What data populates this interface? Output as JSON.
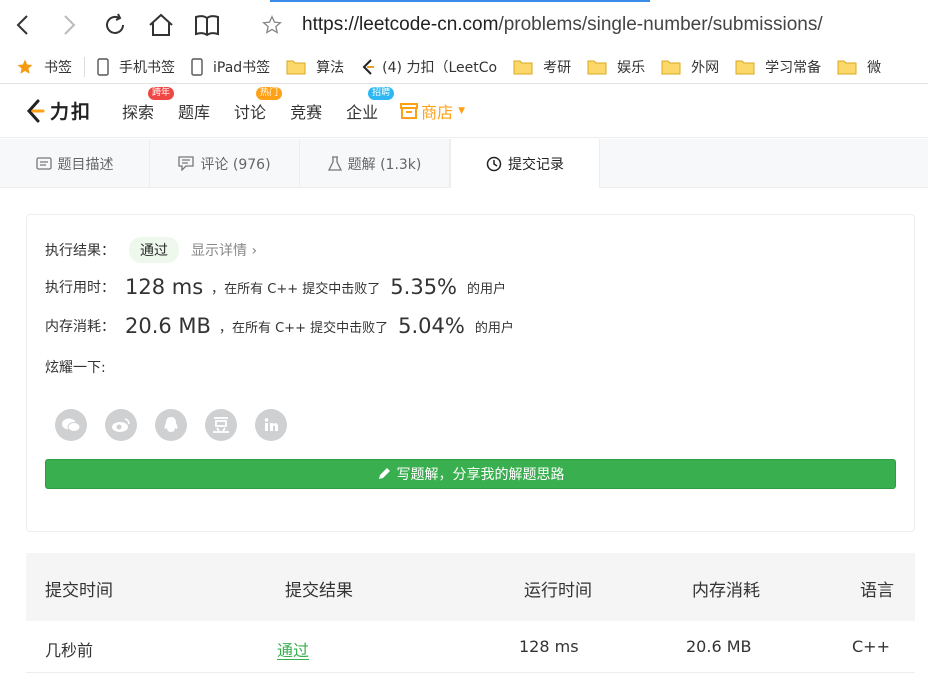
{
  "browser": {
    "url_host": "https://leetcode-cn.com",
    "url_path": "/problems/single-number/submissions/"
  },
  "bookmarks": [
    {
      "label": "书签",
      "icon": "star-icon"
    },
    {
      "label": "手机书签",
      "icon": "phone-icon"
    },
    {
      "label": "iPad书签",
      "icon": "tablet-icon"
    },
    {
      "label": "算法",
      "icon": "folder-icon"
    },
    {
      "label": "(4) 力扣（LeetCo",
      "icon": "leetcode-icon"
    },
    {
      "label": "考研",
      "icon": "folder-icon"
    },
    {
      "label": "娱乐",
      "icon": "folder-icon"
    },
    {
      "label": "外网",
      "icon": "folder-icon"
    },
    {
      "label": "学习常备",
      "icon": "folder-icon"
    },
    {
      "label": "微",
      "icon": "folder-icon"
    }
  ],
  "header": {
    "logo_text": "力扣",
    "nav": [
      {
        "label": "探索",
        "badge": "跨年"
      },
      {
        "label": "题库"
      },
      {
        "label": "讨论",
        "badge": "热门"
      },
      {
        "label": "竞赛"
      },
      {
        "label": "企业",
        "badge": "招聘"
      }
    ],
    "store_label": "商店"
  },
  "tabs": [
    {
      "label": "题目描述"
    },
    {
      "label": "评论 (976)"
    },
    {
      "label": "题解 (1.3k)"
    },
    {
      "label": "提交记录"
    }
  ],
  "result": {
    "status_label": "执行结果：",
    "status_value": "通过",
    "detail_link": "显示详情",
    "runtime_label": "执行用时：",
    "runtime_value": "128 ms",
    "runtime_mid": "，在所有 C++ 提交中击败了",
    "runtime_pct": "5.35%",
    "runtime_tail": "的用户",
    "memory_label": "内存消耗：",
    "memory_value": "20.6 MB",
    "memory_mid": "，在所有 C++ 提交中击败了",
    "memory_pct": "5.04%",
    "memory_tail": "的用户",
    "share_label": "炫耀一下:",
    "write_button": "写题解，分享我的解题思路"
  },
  "table": {
    "headers": [
      "提交时间",
      "提交结果",
      "运行时间",
      "内存消耗",
      "语言"
    ],
    "rows": [
      {
        "time": "几秒前",
        "status": "通过",
        "runtime": "128 ms",
        "memory": "20.6 MB",
        "lang": "C++"
      }
    ]
  }
}
